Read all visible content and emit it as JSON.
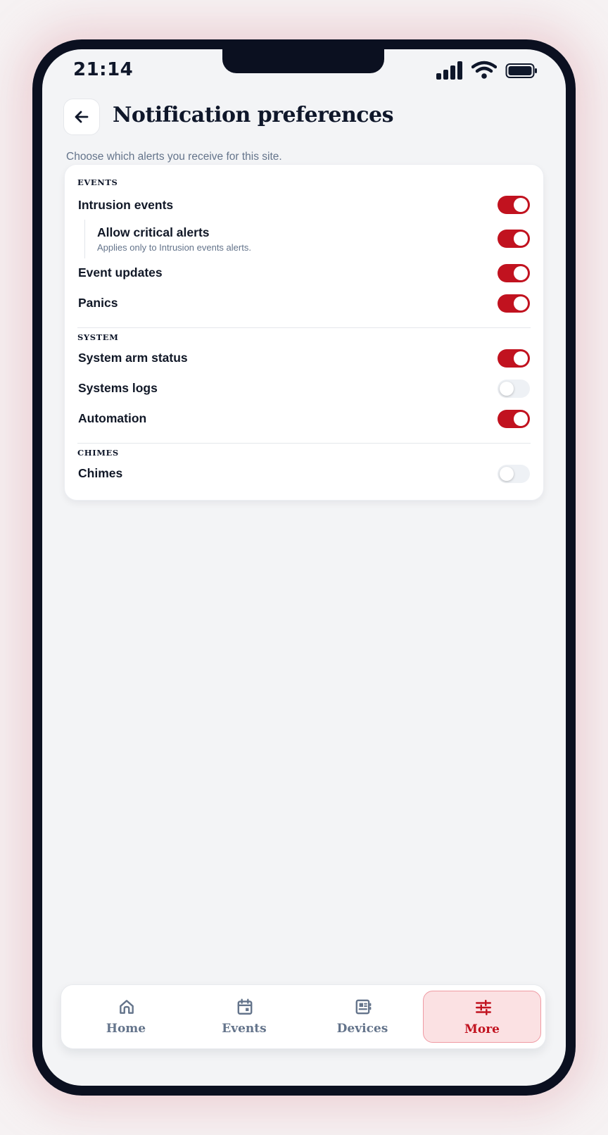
{
  "status_bar": {
    "time": "21:14"
  },
  "header": {
    "title": "Notification preferences",
    "subtitle": "Choose which alerts you receive for this site."
  },
  "sections": {
    "events": {
      "label": "EVENTS",
      "items": [
        {
          "label": "Intrusion events",
          "enabled": true
        },
        {
          "label": "Allow critical alerts",
          "description": "Applies only to Intrusion events alerts.",
          "enabled": true
        },
        {
          "label": "Event updates",
          "enabled": true
        },
        {
          "label": "Panics",
          "enabled": true
        }
      ]
    },
    "system": {
      "label": "SYSTEM",
      "items": [
        {
          "label": "System arm status",
          "enabled": true
        },
        {
          "label": "Systems logs",
          "enabled": false
        },
        {
          "label": "Automation",
          "enabled": true
        }
      ]
    },
    "chimes": {
      "label": "CHIMES",
      "items": [
        {
          "label": "Chimes",
          "enabled": false
        }
      ]
    }
  },
  "tabbar": {
    "tabs": [
      {
        "label": "Home",
        "icon": "home-icon",
        "active": false
      },
      {
        "label": "Events",
        "icon": "calendar-icon",
        "active": false
      },
      {
        "label": "Devices",
        "icon": "devices-icon",
        "active": false
      },
      {
        "label": "More",
        "icon": "sliders-icon",
        "active": true
      }
    ]
  },
  "colors": {
    "accent": "#c1121f",
    "accent_soft": "#fbe1e3",
    "text": "#0f172a",
    "muted": "#64748b"
  }
}
